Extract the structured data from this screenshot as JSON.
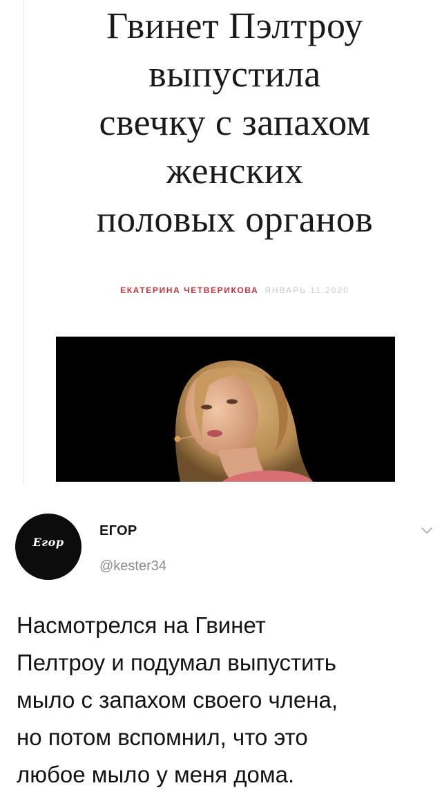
{
  "article": {
    "headline_lines": [
      "Гвинет Пэлтроу",
      "выпустила",
      "свечку с запахом",
      "женских",
      "половых органов"
    ],
    "author": "ЕКАТЕРИНА ЧЕТВЕРИКОВА",
    "date": "ЯНВАРЬ 11.2020",
    "author_color": "#c0343f"
  },
  "tweet": {
    "display_name": "ЕГОР",
    "handle": "@kester34",
    "avatar_text": "Егор",
    "text_lines": [
      "Насмотрелся на Гвинет",
      "Пелтроу и подумал выпустить",
      "мыло с запахом своего члена,",
      "но потом вспомнил, что это",
      "любое мыло у меня дома."
    ],
    "menu_icon": "chevron-down-icon"
  }
}
